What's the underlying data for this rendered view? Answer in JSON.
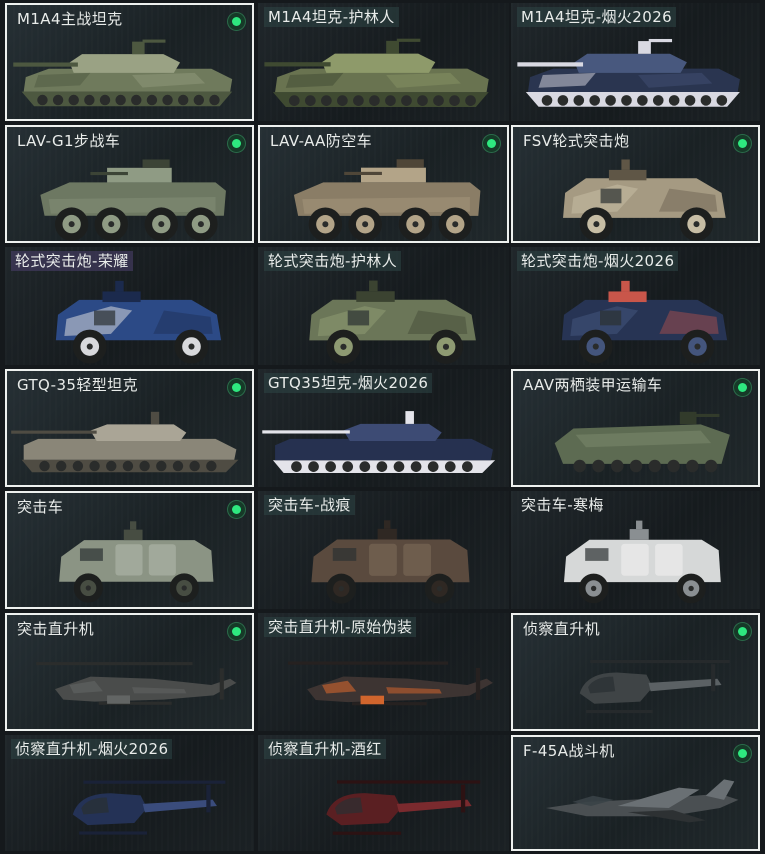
{
  "cards": [
    {
      "label": "M1A4主战坦克",
      "type": "tank",
      "tag": "plain",
      "selected": true,
      "owned": true,
      "colors": [
        "#6f7a5c",
        "#9aa284",
        "#4d5840"
      ]
    },
    {
      "label": "M1A4坦克-护林人",
      "type": "tank",
      "tag": "skin",
      "selected": false,
      "owned": false,
      "colors": [
        "#697350",
        "#8e9a6a",
        "#3f4a31"
      ]
    },
    {
      "label": "M1A4坦克-烟火2026",
      "type": "tank",
      "tag": "skin",
      "selected": false,
      "owned": false,
      "colors": [
        "#2a3550",
        "#48587e",
        "#d9d9e2"
      ]
    },
    {
      "label": "LAV-G1步战车",
      "type": "apc",
      "tag": "plain",
      "selected": true,
      "owned": true,
      "colors": [
        "#6d7862",
        "#8f9b84",
        "#3c4436"
      ]
    },
    {
      "label": "LAV-AA防空车",
      "type": "apc",
      "tag": "plain",
      "selected": true,
      "owned": true,
      "colors": [
        "#8a7d66",
        "#b3a488",
        "#4f4638"
      ]
    },
    {
      "label": "FSV轮式突击炮",
      "type": "mrap",
      "tag": "plain",
      "selected": true,
      "owned": true,
      "colors": [
        "#a59a82",
        "#c7bda4",
        "#5f5646"
      ]
    },
    {
      "label": "轮式突击炮-荣耀",
      "type": "mrap",
      "tag": "prem",
      "selected": false,
      "owned": false,
      "colors": [
        "#2c4a86",
        "#d8d9dc",
        "#1b2a4d"
      ]
    },
    {
      "label": "轮式突击炮-护林人",
      "type": "mrap",
      "tag": "skin",
      "selected": false,
      "owned": false,
      "colors": [
        "#6b7658",
        "#8e9a72",
        "#3b4331"
      ]
    },
    {
      "label": "轮式突击炮-烟火2026",
      "type": "mrap",
      "tag": "skin",
      "selected": false,
      "owned": false,
      "colors": [
        "#273454",
        "#44557c",
        "#c9564a"
      ]
    },
    {
      "label": "GTQ-35轻型坦克",
      "type": "light",
      "tag": "plain",
      "selected": true,
      "owned": true,
      "colors": [
        "#8a8678",
        "#aaa596",
        "#4f4c43"
      ]
    },
    {
      "label": "GTQ35坦克-烟火2026",
      "type": "light",
      "tag": "skin",
      "selected": false,
      "owned": false,
      "colors": [
        "#263150",
        "#3d4b74",
        "#e4e4ea"
      ]
    },
    {
      "label": "AAV两栖装甲运输车",
      "type": "aav",
      "tag": "plain",
      "selected": true,
      "owned": true,
      "colors": [
        "#5d6b52",
        "#7d8b6d",
        "#323b2b"
      ]
    },
    {
      "label": "突击车",
      "type": "truck",
      "tag": "plain",
      "selected": true,
      "owned": true,
      "colors": [
        "#8b9484",
        "#b1b8aa",
        "#474d42"
      ]
    },
    {
      "label": "突击车-战痕",
      "type": "truck",
      "tag": "skin",
      "selected": false,
      "owned": false,
      "colors": [
        "#5a4a3e",
        "#7c6a58",
        "#2f2823"
      ]
    },
    {
      "label": "突击车-寒梅",
      "type": "truck",
      "tag": "plain",
      "selected": false,
      "owned": false,
      "colors": [
        "#d6d8d8",
        "#f0f0f0",
        "#8a8f92"
      ]
    },
    {
      "label": "突击直升机",
      "type": "heli",
      "tag": "plain",
      "selected": true,
      "owned": true,
      "colors": [
        "#4a4c4b",
        "#626564",
        "#2b2d2c"
      ]
    },
    {
      "label": "突击直升机-原始伪装",
      "type": "heli",
      "tag": "skin",
      "selected": false,
      "owned": false,
      "colors": [
        "#3d3432",
        "#d1652d",
        "#262120"
      ]
    },
    {
      "label": "侦察直升机",
      "type": "scout",
      "tag": "plain",
      "selected": true,
      "owned": true,
      "colors": [
        "#3f4446",
        "#5b6164",
        "#262a2c"
      ]
    },
    {
      "label": "侦察直升机-烟火2026",
      "type": "scout",
      "tag": "skin",
      "selected": false,
      "owned": false,
      "colors": [
        "#243256",
        "#3a4c7c",
        "#1a2238"
      ]
    },
    {
      "label": "侦察直升机-酒红",
      "type": "scout",
      "tag": "skin",
      "selected": false,
      "owned": false,
      "colors": [
        "#5a1f22",
        "#7a2a2e",
        "#2c1213"
      ]
    },
    {
      "label": "F-45A战斗机",
      "type": "jet",
      "tag": "plain",
      "selected": true,
      "owned": true,
      "colors": [
        "#4a4f52",
        "#6a7074",
        "#2d3133"
      ]
    }
  ]
}
